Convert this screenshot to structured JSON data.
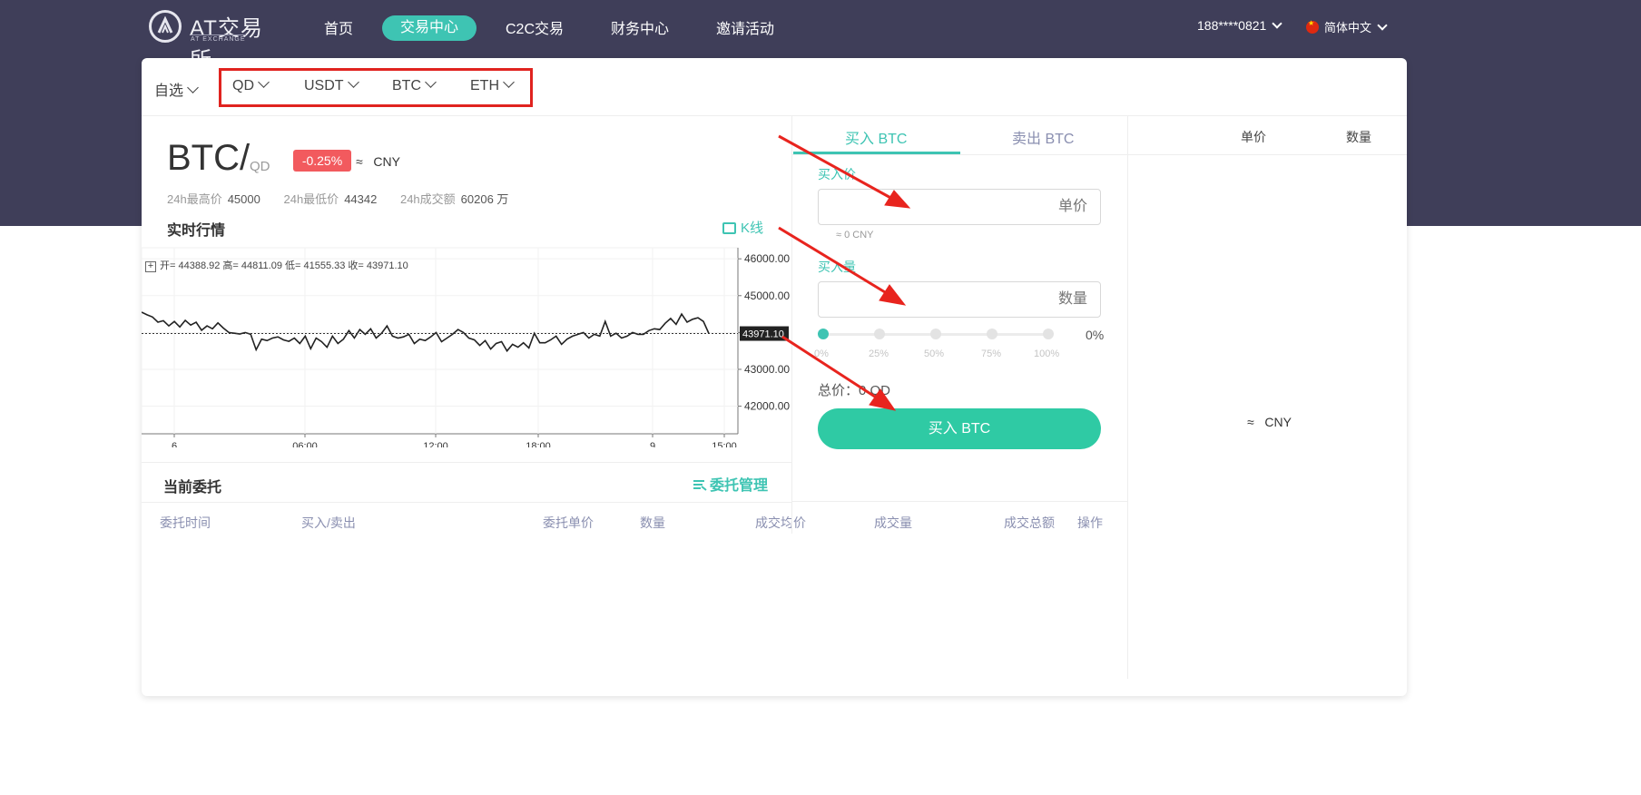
{
  "nav": {
    "logo_text": "AT交易所",
    "logo_sub": "AT EXCHANGE",
    "items": [
      "首页",
      "交易中心",
      "C2C交易",
      "财务中心",
      "邀请活动"
    ],
    "active_index": 1,
    "user": "188****0821",
    "language": "简体中文"
  },
  "market_tabs": {
    "favorites": "自选",
    "items": [
      "QD",
      "USDT",
      "BTC",
      "ETH"
    ]
  },
  "ticker": {
    "base": "BTC/",
    "quote": "QD",
    "change": "-0.25%",
    "approx": "≈",
    "currency": "CNY",
    "stats": [
      {
        "label": "24h最高价",
        "value": "45000"
      },
      {
        "label": "24h最低价",
        "value": "44342"
      },
      {
        "label": "24h成交额",
        "value": "60206 万"
      }
    ]
  },
  "realtime": {
    "title": "实时行情",
    "kline": "K线",
    "ohlc_text": "开= 44388.92  高= 44811.09  低= 41555.33  收= 43971.10"
  },
  "chart_data": {
    "type": "line",
    "x_ticks": [
      "6",
      "06:00",
      "12:00",
      "18:00",
      "9",
      "15:00"
    ],
    "y_ticks": [
      46000,
      45000,
      44000,
      43000,
      42000
    ],
    "y_tick_labels": [
      "46000.00",
      "45000.00",
      "",
      "43000.00",
      "42000.00"
    ],
    "ylim": [
      41250,
      46300
    ],
    "last_value": 43971.1,
    "last_label": "43971.10",
    "grid": true,
    "series": [
      {
        "values": [
          44550,
          44480,
          44420,
          44280,
          44320,
          44180,
          44300,
          44150,
          44330,
          44200,
          44280,
          44060,
          44180,
          44100,
          44260,
          44120,
          44000,
          43980,
          43960,
          44000,
          43950,
          43530,
          43820,
          43780,
          43850,
          43880,
          43800,
          43760,
          43850,
          43700,
          43900,
          43560,
          43850,
          43750,
          43600,
          43900,
          43700,
          43820,
          44050,
          43850,
          44080,
          43950,
          44100,
          43850,
          43980,
          44180,
          43900,
          43850,
          43880,
          43950,
          43700,
          43820,
          43780,
          43880,
          44000,
          43750,
          43850,
          43950,
          44080,
          44000,
          43850,
          43800,
          43650,
          43780,
          43550,
          43700,
          43750,
          43500,
          43680,
          43600,
          43720,
          43580,
          43980,
          43720,
          43720,
          43800,
          43900,
          43680,
          43820,
          43900,
          43950,
          44000,
          43850,
          43950,
          43900,
          44300,
          43900,
          43980,
          43850,
          43900,
          44000,
          43950,
          43950,
          44050,
          44100,
          44080,
          44250,
          44380,
          44220,
          44500,
          44280,
          44360,
          44400,
          44300,
          43971
        ]
      }
    ]
  },
  "orders": {
    "title": "当前委托",
    "manage": "委托管理",
    "columns": [
      "委托时间",
      "买入/卖出",
      "委托单价",
      "数量",
      "成交均价",
      "成交量",
      "成交总额",
      "操作"
    ]
  },
  "trade": {
    "buy_tab": "买入 BTC",
    "sell_tab": "卖出 BTC",
    "price_label": "买入价",
    "price_placeholder": "单价",
    "cny_hint": "≈ 0 CNY",
    "qty_label": "买入量",
    "qty_placeholder": "数量",
    "slider_labels": [
      "0%",
      "25%",
      "50%",
      "75%",
      "100%"
    ],
    "slider_value": "0%",
    "total": "总价：0 QD",
    "buy_button": "买入 BTC"
  },
  "orderbook": {
    "price_head": "单价",
    "qty_head": "数量",
    "approx": "≈",
    "currency": "CNY"
  },
  "colors": {
    "header_bg": "#3f3e59",
    "accent": "#3ec4b3",
    "buy_button": "#2fcaa4",
    "down": "#f25a5e",
    "annotation": "#e0231f"
  }
}
